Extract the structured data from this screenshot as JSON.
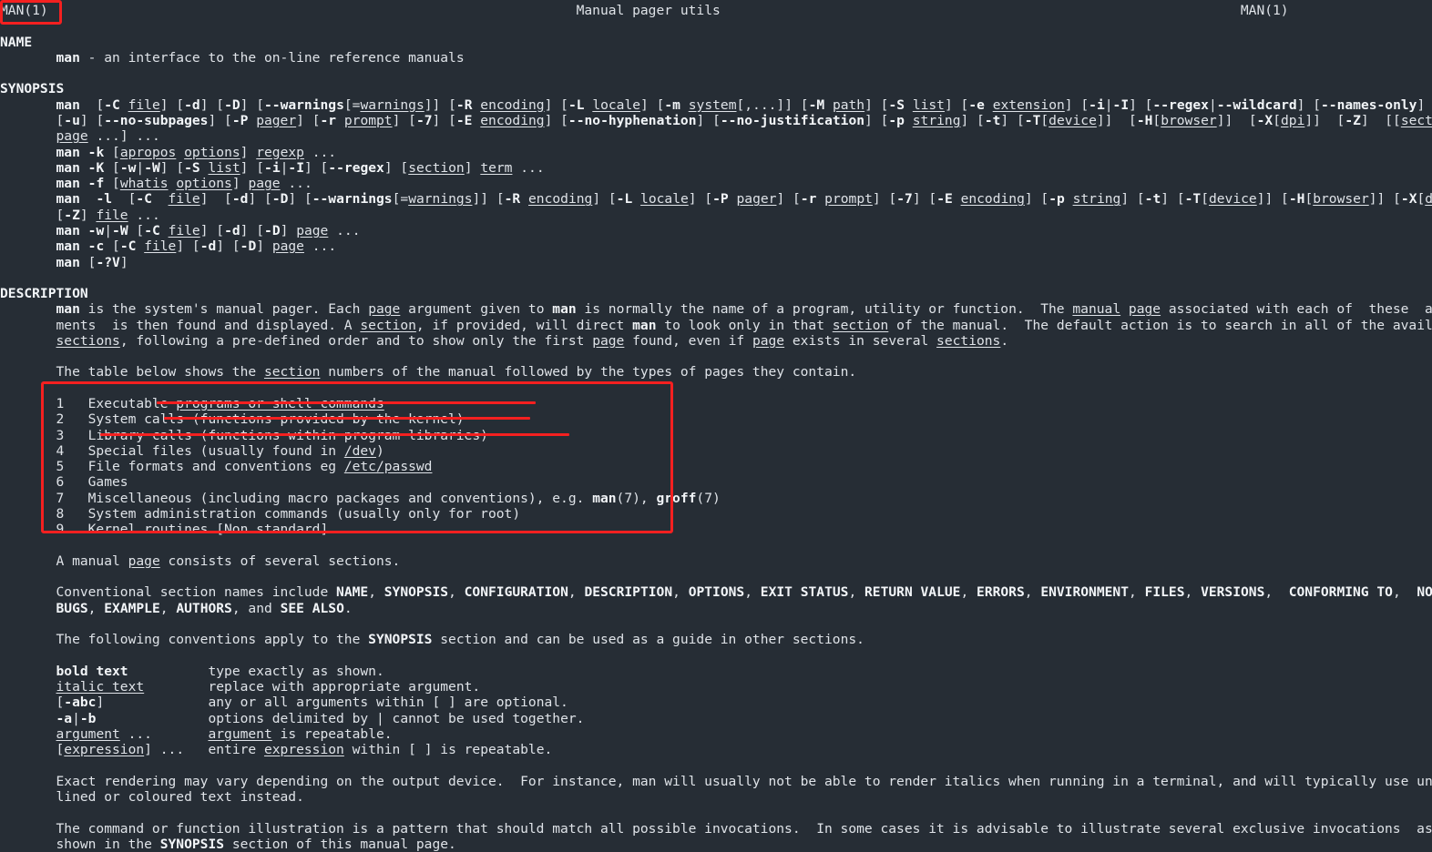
{
  "terminal": {
    "background_color": "#262d35",
    "foreground_color": "#dfe3e8",
    "annotation_color": "#f42020"
  },
  "header": {
    "left": "MAN(1)",
    "center": "Manual pager utils",
    "right": "MAN(1)"
  },
  "sections": {
    "name": {
      "heading": "NAME",
      "body": "       man - an interface to the on-line reference manuals"
    },
    "synopsis": {
      "heading": "SYNOPSIS"
    },
    "description": {
      "heading": "DESCRIPTION"
    }
  },
  "synopsis_lines": [
    "       man  [-C file] [-d] [-D] [--warnings[=warnings]] [-R encoding] [-L locale] [-m system[,...]] [-M path] [-S list] [-e extension] [-i|-I] [--regex|--wildcard] [--names-only] [-a]",
    "       [-u] [--no-subpages] [-P pager] [-r prompt] [-7] [-E encoding] [--no-hyphenation] [--no-justification] [-p string] [-t] [-T[device]]  [-H[browser]]  [-X[dpi]]  [-Z]  [[section]",
    "       page ...] ...",
    "       man -k [apropos options] regexp ...",
    "       man -K [-w|-W] [-S list] [-i|-I] [--regex] [section] term ...",
    "       man -f [whatis options] page ...",
    "       man  -l  [-C  file]  [-d] [-D] [--warnings[=warnings]] [-R encoding] [-L locale] [-P pager] [-r prompt] [-7] [-E encoding] [-p string] [-t] [-T[device]] [-H[browser]] [-X[dpi]]",
    "       [-Z] file ...",
    "       man -w|-W [-C file] [-d] [-D] page ...",
    "       man -c [-C file] [-d] [-D] page ...",
    "       man [-?V]"
  ],
  "description_paragraphs": [
    "       man is the system's manual pager. Each page argument given to man is normally the name of a program, utility or function.  The manual page associated with each of  these  argu-\n       ments  is then found and displayed. A section, if provided, will direct man to look only in that section of the manual.  The default action is to search in all of the available\n       sections, following a pre-defined order and to show only the first page found, even if page exists in several sections.",
    "       The table below shows the section numbers of the manual followed by the types of pages they contain.",
    "       A manual page consists of several sections.",
    "       Conventional section names include NAME, SYNOPSIS, CONFIGURATION, DESCRIPTION, OPTIONS, EXIT STATUS, RETURN VALUE, ERRORS, ENVIRONMENT, FILES, VERSIONS,  CONFORMING TO,  NOTES,\n       BUGS, EXAMPLE, AUTHORS, and SEE ALSO.",
    "       The following conventions apply to the SYNOPSIS section and can be used as a guide in other sections.",
    "       Exact rendering may vary depending on the output device.  For instance, man will usually not be able to render italics when running in a terminal, and will typically use under-\n       lined or coloured text instead.",
    "       The command or function illustration is a pattern that should match all possible invocations.  In some cases it is advisable to illustrate several exclusive invocations  as  is\n       shown in the SYNOPSIS section of this manual page."
  ],
  "section_table": {
    "rows": [
      {
        "number": "1",
        "text": "Executable programs or shell commands"
      },
      {
        "number": "2",
        "text": "System calls (functions provided by the kernel)"
      },
      {
        "number": "3",
        "text": "Library calls (functions within program libraries)"
      },
      {
        "number": "4",
        "text": "Special files (usually found in /dev)"
      },
      {
        "number": "5",
        "text": "File formats and conventions eg /etc/passwd"
      },
      {
        "number": "6",
        "text": "Games"
      },
      {
        "number": "7",
        "text": "Miscellaneous (including macro packages and conventions), e.g. man(7), groff(7)"
      },
      {
        "number": "8",
        "text": "System administration commands (usually only for root)"
      },
      {
        "number": "9",
        "text": "Kernel routines [Non standard]"
      }
    ]
  },
  "conventions_table": {
    "rows": [
      {
        "term": "bold text",
        "definition": "type exactly as shown."
      },
      {
        "term": "italic text",
        "definition": "replace with appropriate argument."
      },
      {
        "term": "[-abc]",
        "definition": "any or all arguments within [ ] are optional."
      },
      {
        "term": "-a|-b",
        "definition": "options delimited by | cannot be used together."
      },
      {
        "term": "argument ...",
        "definition": "argument is repeatable."
      },
      {
        "term": "[expression] ...",
        "definition": "entire expression within [ ] is repeatable."
      }
    ]
  },
  "annotations": [
    {
      "kind": "box",
      "target": "header-left-man1"
    },
    {
      "kind": "box",
      "target": "section-table"
    },
    {
      "kind": "underline",
      "target": "section-row-1"
    },
    {
      "kind": "underline",
      "target": "section-row-2"
    },
    {
      "kind": "underline",
      "target": "section-row-3"
    }
  ]
}
